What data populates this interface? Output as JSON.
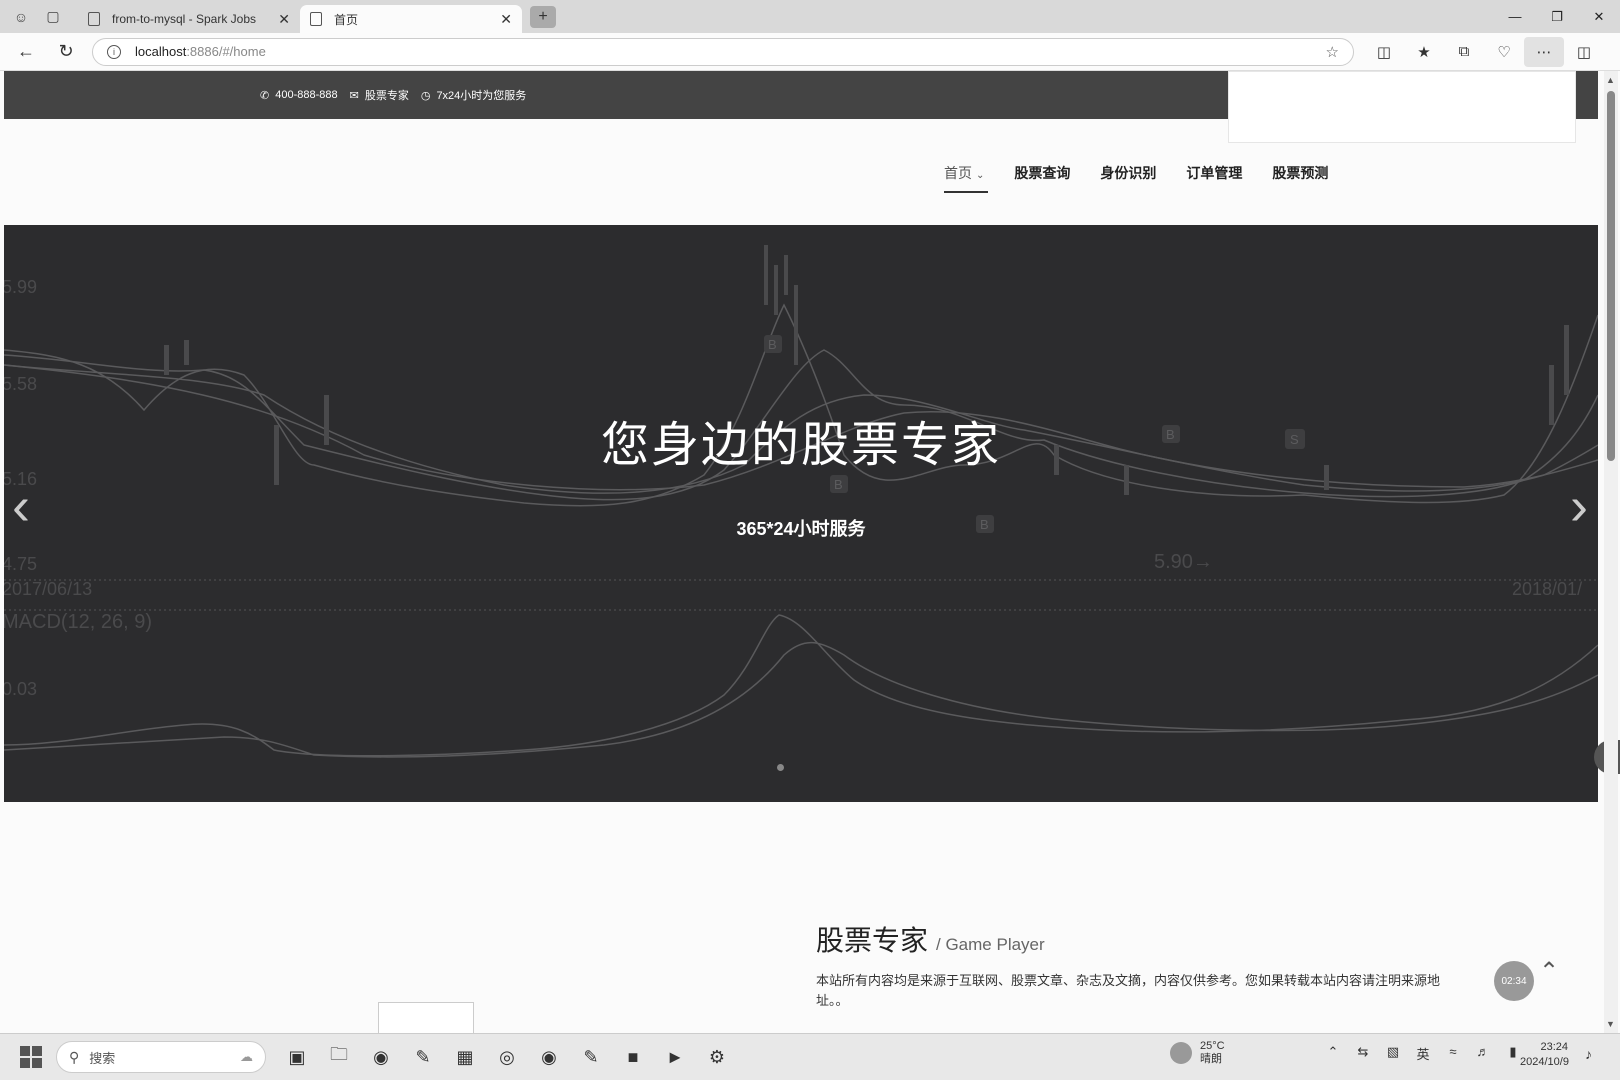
{
  "browser": {
    "tabs": [
      {
        "title": "from-to-mysql - Spark Jobs",
        "close": "✕"
      },
      {
        "title": "首页",
        "close": "✕"
      }
    ],
    "url_host": "localhost",
    "url_rest": ":8886/#/home"
  },
  "topbar": {
    "phone": "400-888-888",
    "email_label": "股票专家",
    "service": "7x24小时为您服务"
  },
  "nav": {
    "items": [
      "首页",
      "股票查询",
      "身份识别",
      "订单管理",
      "股票预测"
    ]
  },
  "hero": {
    "title": "您身边的股票专家",
    "subtitle": "365*24小时服务",
    "chart_labels": {
      "price_top": "5.99",
      "price_2": "5.58",
      "price_3": "5.16",
      "price_4": "4.75",
      "date_left": "2017/06/13",
      "date_right": "2018/01/",
      "macd": "MACD(12, 26, 9)",
      "macd_val": "0.03",
      "marker_b": "B",
      "marker_s": "S",
      "arrow_value": "5.90→"
    }
  },
  "section": {
    "title": "股票专家",
    "subtitle": "/ Game Player",
    "description": "本站所有内容均是来源于互联网、股票文章、杂志及文摘，内容仅供参考。您如果转载本站内容请注明来源地址。。"
  },
  "timer": "02:34",
  "taskbar": {
    "search_placeholder": "搜索",
    "weather_temp": "25°C",
    "weather_desc": "晴朗",
    "ime": "英",
    "time": "23:24",
    "date": "2024/10/9"
  }
}
